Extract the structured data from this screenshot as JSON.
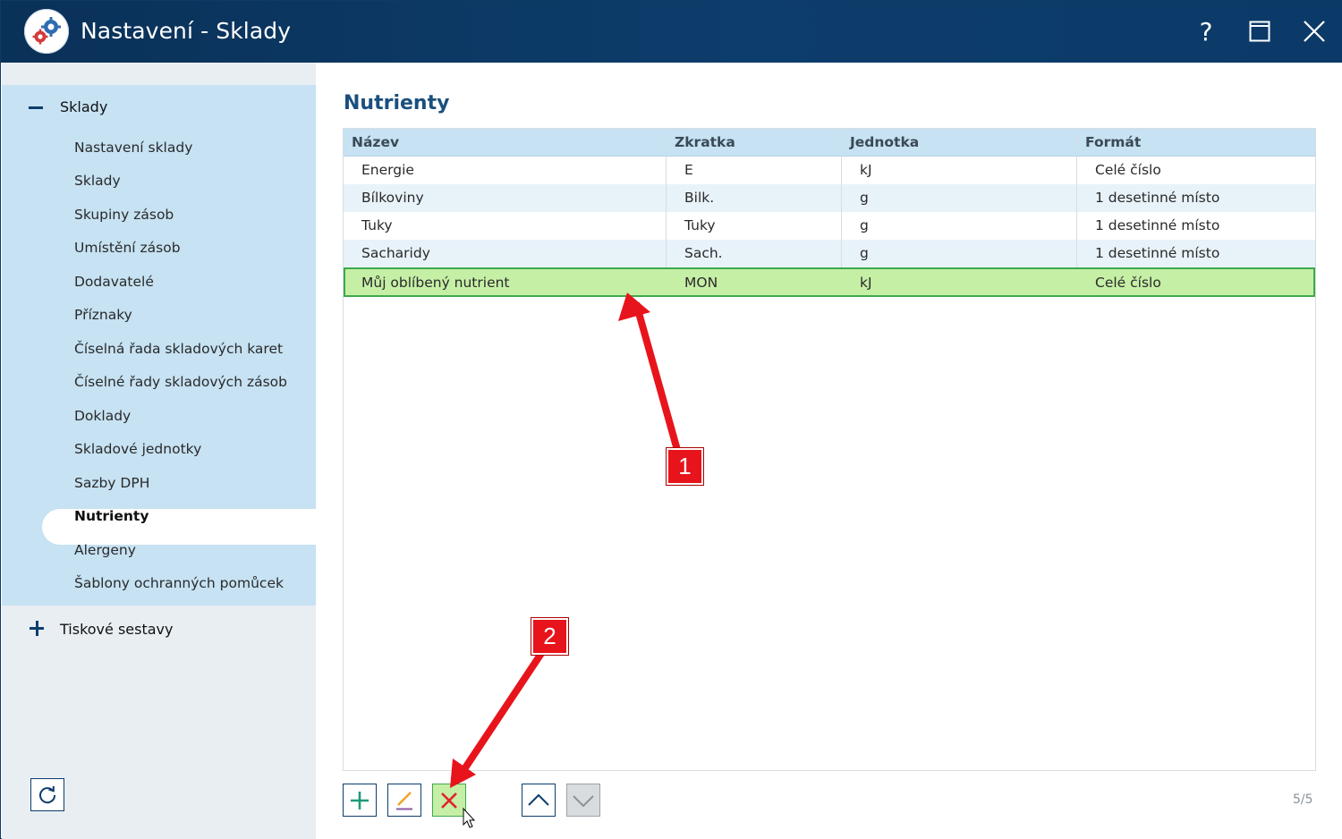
{
  "window": {
    "title": "Nastavení - Sklady",
    "help_symbol": "?"
  },
  "sidebar": {
    "group1_label": "Sklady",
    "items": [
      {
        "label": "Nastavení sklady"
      },
      {
        "label": "Sklady"
      },
      {
        "label": "Skupiny zásob"
      },
      {
        "label": "Umístění zásob"
      },
      {
        "label": "Dodavatelé"
      },
      {
        "label": "Příznaky"
      },
      {
        "label": "Číselná řada skladových karet"
      },
      {
        "label": "Číselné řady skladových zásob"
      },
      {
        "label": "Doklady"
      },
      {
        "label": "Skladové jednotky"
      },
      {
        "label": "Sazby DPH"
      },
      {
        "label": "Nutrienty"
      },
      {
        "label": "Alergeny"
      },
      {
        "label": "Šablony ochranných pomůcek"
      }
    ],
    "selected_index": 11,
    "group2_label": "Tiskové sestavy"
  },
  "main": {
    "title": "Nutrienty",
    "columns": [
      "Název",
      "Zkratka",
      "Jednotka",
      "Formát"
    ],
    "rows": [
      {
        "name": "Energie",
        "abbr": "E",
        "unit": "kJ",
        "format": "Celé číslo"
      },
      {
        "name": "Bílkoviny",
        "abbr": "Bilk.",
        "unit": "g",
        "format": "1 desetinné místo"
      },
      {
        "name": "Tuky",
        "abbr": "Tuky",
        "unit": "g",
        "format": "1 desetinné místo"
      },
      {
        "name": "Sacharidy",
        "abbr": "Sach.",
        "unit": "g",
        "format": "1 desetinné místo"
      },
      {
        "name": "Můj oblíbený nutrient",
        "abbr": "MON",
        "unit": "kJ",
        "format": "Celé číslo"
      }
    ],
    "selected_row": 4,
    "counter": "5/5"
  },
  "annotations": {
    "badge1": "1",
    "badge2": "2"
  },
  "colors": {
    "titlebar": "#0d3d6c",
    "sidebar_group": "#c6e2f3",
    "selected_row": "#c6efa6",
    "selected_border": "#3ea94a",
    "heading": "#1a4f7e",
    "annotation_red": "#e8141b"
  }
}
